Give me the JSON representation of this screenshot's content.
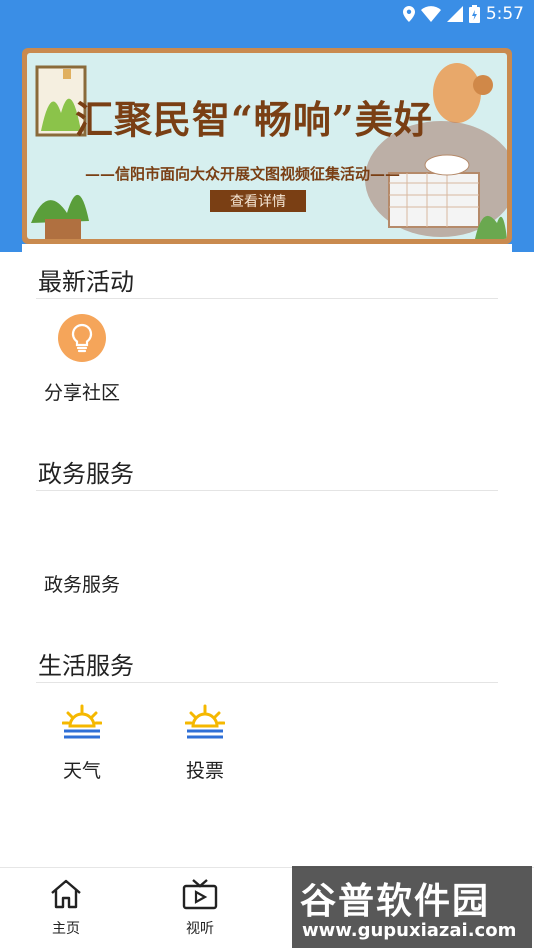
{
  "status_bar": {
    "time": "5:57"
  },
  "banner": {
    "title": "汇聚民智“畅响”美好",
    "subtitle": "——信阳市面向大众开展文图视频征集活动——",
    "button_label": "查看详情"
  },
  "sections": {
    "latest": {
      "title": "最新活动",
      "items": [
        {
          "label": "分享社区",
          "icon": "bulb-icon"
        }
      ]
    },
    "gov": {
      "title": "政务服务",
      "items": [
        {
          "label": "政务服务"
        }
      ]
    },
    "life": {
      "title": "生活服务",
      "items": [
        {
          "label": "天气",
          "icon": "sunrise-icon"
        },
        {
          "label": "投票",
          "icon": "sunrise-icon"
        }
      ]
    }
  },
  "bottom_nav": [
    {
      "label": "主页",
      "icon": "home-icon"
    },
    {
      "label": "视听",
      "icon": "video-icon"
    }
  ],
  "watermark": {
    "main": "谷普软件园",
    "url": "www.gupuxiazai.com"
  },
  "colors": {
    "header_blue": "#3a8ee6",
    "banner_brown": "#7a3f14",
    "bulb_orange": "#f5a55a",
    "sun_yellow": "#f5b800",
    "sun_blue": "#2f6fd6"
  }
}
